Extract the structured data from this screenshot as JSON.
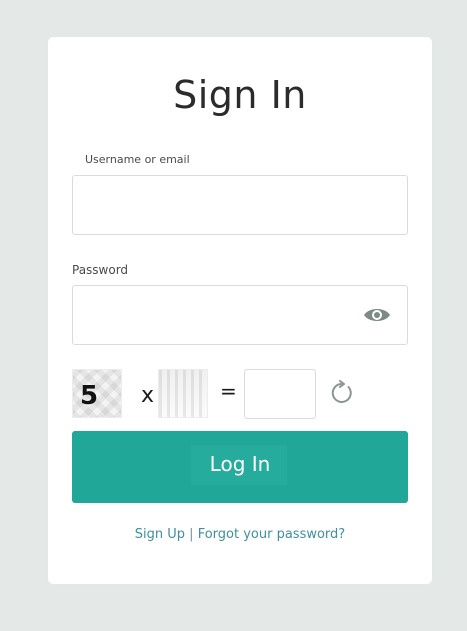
{
  "title": "Sign In",
  "username": {
    "label": "Username or email",
    "value": ""
  },
  "password": {
    "label": "Password",
    "value": "",
    "toggle_icon": "eye-icon"
  },
  "captcha": {
    "first_operand": "5",
    "multiplier_text": "x 40",
    "equals": "=",
    "answer": "",
    "refresh_icon": "refresh-icon"
  },
  "login_button": {
    "label": "Log In"
  },
  "links": {
    "sign_up": "Sign Up",
    "separator": "|",
    "forgot_password": "Forgot your password?"
  },
  "colors": {
    "background": "#e4e9e7",
    "accent": "#21a797",
    "link": "#3e8fa0"
  }
}
